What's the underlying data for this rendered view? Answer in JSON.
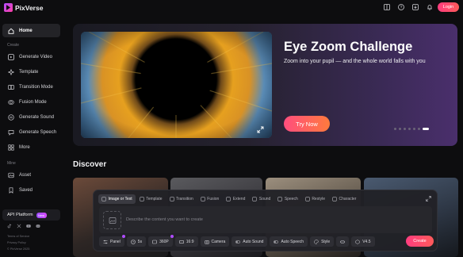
{
  "app": {
    "name": "PixVerse"
  },
  "header": {
    "login_label": "Login",
    "icons": [
      "layout-icon",
      "help-icon",
      "download-icon",
      "notification-icon"
    ]
  },
  "sidebar": {
    "home": "Home",
    "create_section": "Create",
    "create_items": [
      "Generate Video",
      "Template",
      "Transition Mode",
      "Fusion Mode",
      "Generate Sound",
      "Generate Speech",
      "More"
    ],
    "mine_section": "Mine",
    "mine_items": [
      "Asset",
      "Saved"
    ],
    "api_label": "API Platform",
    "api_badge": "New",
    "footer": [
      "Terms of Service",
      "Privacy Policy",
      "© PixVerse 2025"
    ]
  },
  "banner": {
    "title": "Eye Zoom Challenge",
    "subtitle": "Zoom into your pupil — and the whole world falls with you",
    "cta": "Try Now",
    "slide_count": 7,
    "active_slide": 6
  },
  "discover": {
    "title": "Discover"
  },
  "creator": {
    "tabs": [
      "Image or Text",
      "Template",
      "Transition",
      "Fusion",
      "Extend",
      "Sound",
      "Speech",
      "Restyle",
      "Character"
    ],
    "active_tab": 0,
    "prompt_placeholder": "Describe the content you want to create",
    "options": {
      "panel": "Panel",
      "duration": "5s",
      "quality": "360P",
      "ratio": "16:9",
      "camera": "Camera",
      "sound": "Auto Sound",
      "speech": "Auto Speech",
      "style": "Style",
      "model": "V4.5"
    },
    "create_label": "Create"
  },
  "colors": {
    "accent": "#ff4e7e",
    "brand": "#b04cff",
    "background": "#0d0d0f"
  }
}
